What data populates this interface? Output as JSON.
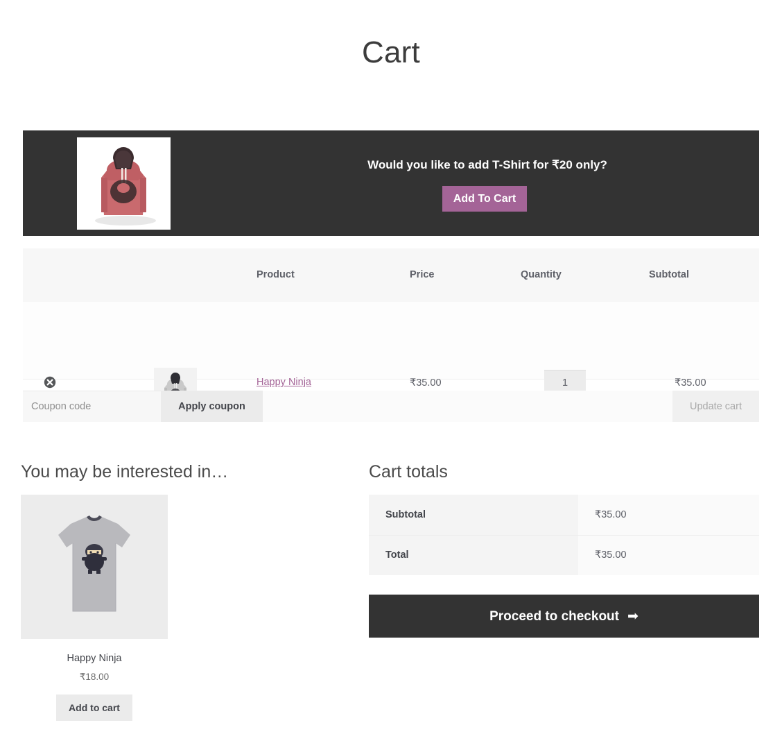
{
  "page": {
    "title": "Cart"
  },
  "promo_banner": {
    "message": "Would you like to add T-Shirt for ₹20 only?",
    "button_label": "Add To Cart",
    "button_color": "#a46497",
    "background_color": "#333333",
    "product_image_alt": "red-hoodie-thumbnail"
  },
  "cart_table": {
    "headers": {
      "product": "Product",
      "price": "Price",
      "quantity": "Quantity",
      "subtotal": "Subtotal"
    },
    "rows": [
      {
        "remove_icon": "remove-circle-icon",
        "thumbnail_alt": "grey-hoodie-thumbnail",
        "name": "Happy Ninja",
        "price": "₹35.00",
        "quantity": "1",
        "subtotal": "₹35.00",
        "link_color": "#a46497"
      }
    ]
  },
  "coupon": {
    "placeholder": "Coupon code",
    "value": "",
    "apply_label": "Apply coupon",
    "update_cart_label": "Update cart",
    "update_cart_disabled": true
  },
  "upsells": {
    "heading": "You may be interested in…",
    "products": [
      {
        "name": "Happy Ninja",
        "price": "₹18.00",
        "add_to_cart_label": "Add to cart",
        "image_alt": "grey-ninja-tshirt"
      }
    ]
  },
  "cart_totals": {
    "heading": "Cart totals",
    "rows": [
      {
        "label": "Subtotal",
        "value": "₹35.00"
      },
      {
        "label": "Total",
        "value": "₹35.00"
      }
    ],
    "checkout_label": "Proceed to checkout",
    "checkout_arrow": "➡",
    "checkout_bg": "#333333"
  }
}
